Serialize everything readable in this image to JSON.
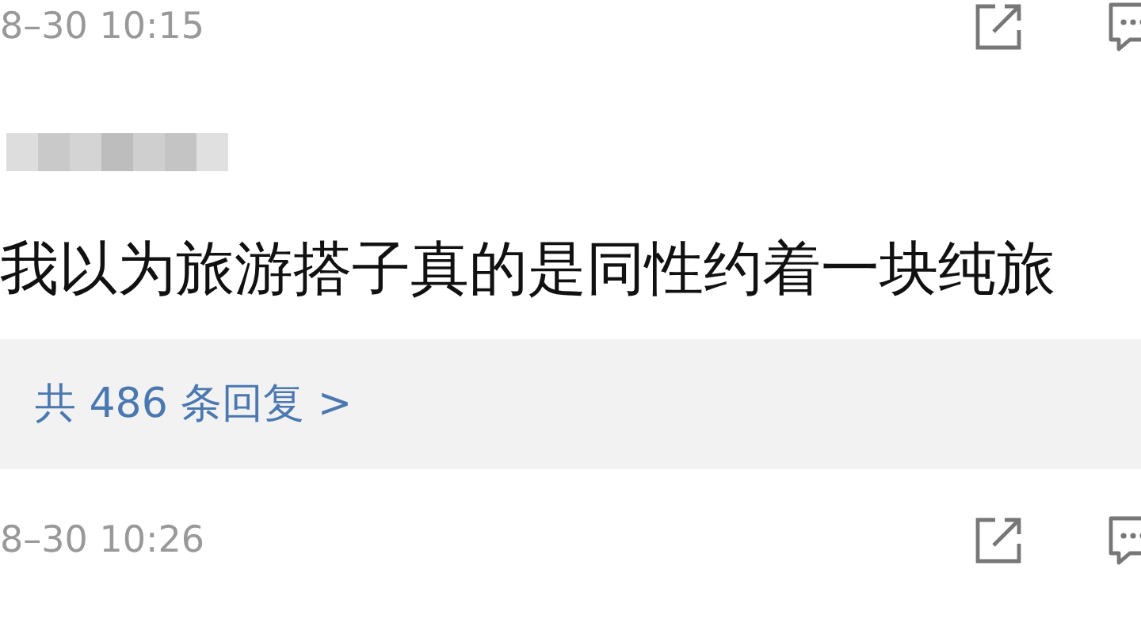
{
  "previous_comment": {
    "time": "8–30 10:15"
  },
  "comment": {
    "text": "我以为旅游搭子真的是同性约着一块纯旅",
    "replies_link": "共 486 条回复 >",
    "time": "8–30 10:26"
  }
}
